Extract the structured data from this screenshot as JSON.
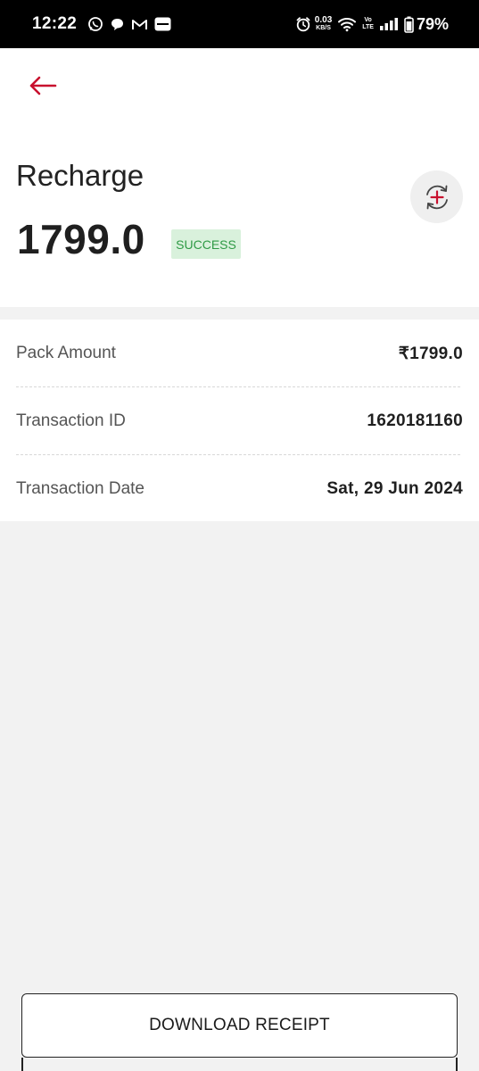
{
  "status_bar": {
    "time": "12:22",
    "left_icons": [
      "whatsapp-icon",
      "chat-icon",
      "gmail-icon",
      "paytm-icon"
    ],
    "net_speed_value": "0.03",
    "net_speed_unit": "KB/S",
    "volte_top": "Vo",
    "volte_bottom": "LTE",
    "battery_percent": "79%"
  },
  "header": {
    "title": "Recharge",
    "amount": "1799.0",
    "status": "SUCCESS"
  },
  "details": [
    {
      "label": "Pack Amount",
      "value": "₹1799.0"
    },
    {
      "label": "Transaction ID",
      "value": "1620181160"
    },
    {
      "label": "Transaction Date",
      "value": "Sat, 29 Jun 2024"
    }
  ],
  "actions": {
    "download_label": "DOWNLOAD RECEIPT"
  },
  "colors": {
    "accent_red": "#c8102e",
    "success_bg": "#d9f1dc",
    "success_text": "#2f9a45",
    "page_bg": "#f2f2f2"
  }
}
